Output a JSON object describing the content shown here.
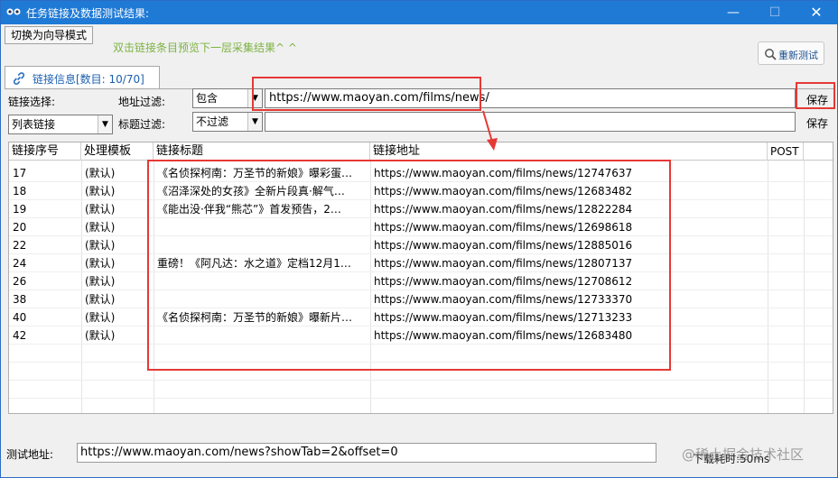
{
  "window": {
    "title": "任务链接及数据测试结果:",
    "min_glyph": "—",
    "max_glyph": "☐",
    "close_glyph": "✕"
  },
  "toolbar": {
    "wizard_button": "切换为向导模式",
    "hint": "双击链接条目预览下一层采集结果^ ^",
    "retest_button": "重新测试"
  },
  "tab": {
    "label": "链接信息[数目: 10/70]"
  },
  "filters": {
    "link_select_label": "链接选择:",
    "link_select_value": "列表链接",
    "url_filter_label": "地址过滤:",
    "url_filter_mode": "包含",
    "url_filter_value": "https://www.maoyan.com/films/news/",
    "url_save": "保存",
    "title_filter_label": "标题过滤:",
    "title_filter_mode": "不过滤",
    "title_filter_value": "",
    "title_save": "保存"
  },
  "grid": {
    "columns": [
      "链接序号",
      "处理模板",
      "链接标题",
      "链接地址",
      "POST"
    ],
    "rows": [
      {
        "id": "17",
        "template": "(默认)",
        "title": "《名侦探柯南：万圣节的新娘》曝彩蛋…",
        "url": "https://www.maoyan.com/films/news/12747637"
      },
      {
        "id": "18",
        "template": "(默认)",
        "title": "《沼泽深处的女孩》全新片段真·解气…",
        "url": "https://www.maoyan.com/films/news/12683482"
      },
      {
        "id": "19",
        "template": "(默认)",
        "title": "《能出没·伴我“熊芯”》首发预告，2…",
        "url": "https://www.maoyan.com/films/news/12822284"
      },
      {
        "id": "20",
        "template": "(默认)",
        "title": "",
        "url": "https://www.maoyan.com/films/news/12698618"
      },
      {
        "id": "22",
        "template": "(默认)",
        "title": "",
        "url": "https://www.maoyan.com/films/news/12885016"
      },
      {
        "id": "24",
        "template": "(默认)",
        "title": "重磅！《阿凡达：水之道》定档12月1…",
        "url": "https://www.maoyan.com/films/news/12807137"
      },
      {
        "id": "26",
        "template": "(默认)",
        "title": "",
        "url": "https://www.maoyan.com/films/news/12708612"
      },
      {
        "id": "38",
        "template": "(默认)",
        "title": "",
        "url": "https://www.maoyan.com/films/news/12733370"
      },
      {
        "id": "40",
        "template": "(默认)",
        "title": "《名侦探柯南：万圣节的新娘》曝新片…",
        "url": "https://www.maoyan.com/films/news/12713233"
      },
      {
        "id": "42",
        "template": "(默认)",
        "title": "",
        "url": "https://www.maoyan.com/films/news/12683480"
      }
    ]
  },
  "footer": {
    "test_url_label": "测试地址:",
    "test_url_value": "https://www.maoyan.com/news?showTab=2&offset=0",
    "timing": "下载耗时:50ms",
    "watermark": "@稀土掘金技术社区"
  },
  "colors": {
    "titlebar": "#1f7ad6",
    "hint": "#7cb342",
    "tab_label": "#1c5fb0",
    "annotation_red": "#e53935"
  },
  "icons": [
    "app-icon",
    "search-icon",
    "link-icon",
    "dropdown-arrow-icon"
  ]
}
